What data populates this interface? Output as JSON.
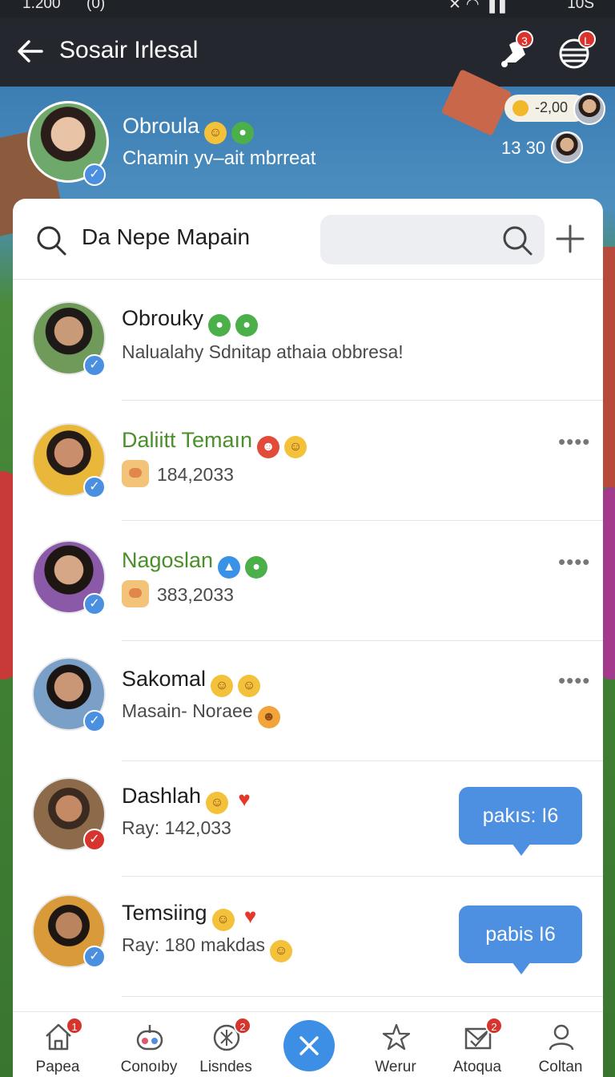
{
  "status_bar": {
    "time": "1.200",
    "carrier": "(0)",
    "battery": "10S"
  },
  "app_bar": {
    "title": "Sosair Irlesal",
    "notif_badge": "3",
    "globe_badge": "L"
  },
  "profile": {
    "name": "Obroula",
    "status": "Chamin yv–ait mbrreat",
    "coins": "-2,00",
    "time": "13 30"
  },
  "panel": {
    "title": "Da Nepe Mapain",
    "search_placeholder": ""
  },
  "chats": [
    {
      "name": "Obrouky",
      "subtitle": "Nalualahy Sdnitap athaia obbresa!",
      "name_color": "dark"
    },
    {
      "name": "Daliitt Temaın",
      "subtitle": "184,2033",
      "name_color": "green"
    },
    {
      "name": "Nagoslan",
      "subtitle": "383,2033",
      "name_color": "green"
    },
    {
      "name": "Sakomal",
      "subtitle": "Masain- Noraee",
      "name_color": "dark"
    },
    {
      "name": "Dashlah",
      "subtitle": "Ray: 142,033",
      "bubble": "pakıs: I6",
      "name_color": "dark"
    },
    {
      "name": "Temsiing",
      "subtitle": "Ray: 180 makdas",
      "bubble": "pabis I6",
      "name_color": "dark"
    }
  ],
  "nav": [
    {
      "label": "Papea",
      "badge": "1"
    },
    {
      "label": "Conoıby",
      "badge": ""
    },
    {
      "label": "Lisndes",
      "badge": "2"
    },
    {
      "label": "Werur",
      "badge": ""
    },
    {
      "label": "Atoqua",
      "badge": "2"
    },
    {
      "label": "Coltan",
      "badge": ""
    }
  ],
  "colors": {
    "accent": "#4d8fe0",
    "green_name": "#4a8f2a",
    "badge": "#d6342c"
  }
}
